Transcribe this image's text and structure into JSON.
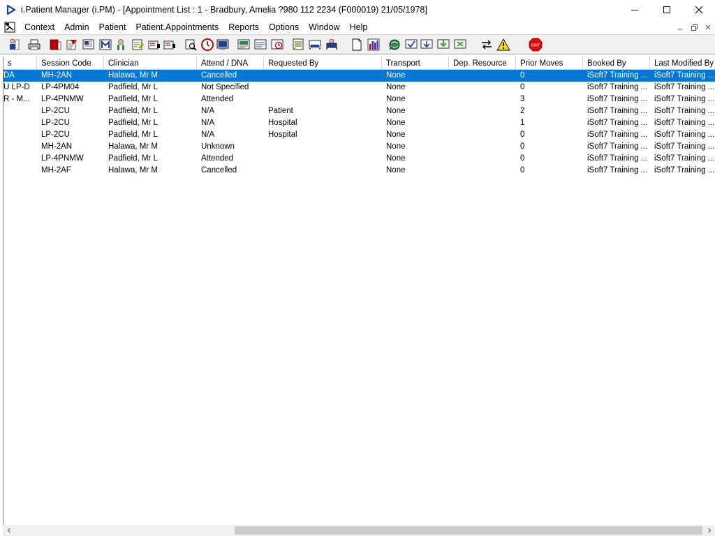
{
  "window": {
    "title": "i.Patient Manager (i.PM) - [Appointment List : 1 - Bradbury, Amelia ?980 112 2234 (F000019) 21/05/1978]"
  },
  "menu": {
    "items": [
      "Context",
      "Admin",
      "Patient",
      "Patient.Appointments",
      "Reports",
      "Options",
      "Window",
      "Help"
    ]
  },
  "toolbar": {
    "exit_label": "EXIT"
  },
  "list": {
    "columns": [
      "s",
      "Session Code",
      "Clinician",
      "Attend / DNA",
      "Requested By",
      "Transport",
      "Dep. Resource",
      "Prior Moves",
      "Booked By",
      "Last Modified By"
    ],
    "rows": [
      [
        "DA",
        "MH-2AN",
        "Halawa, Mr M",
        "Cancelled",
        "",
        "None",
        "",
        "0",
        "iSoft7 Training ...",
        "iSoft7 Training ..."
      ],
      [
        "U LP-D",
        "LP-4PM04",
        "Padfield, Mr L",
        "Not Specified",
        "",
        "None",
        "",
        "0",
        "iSoft7 Training ...",
        "iSoft7 Training ..."
      ],
      [
        "R - M...",
        "LP-4PNMW",
        "Padfield, Mr L",
        "Attended",
        "",
        "None",
        "",
        "3",
        "iSoft7 Training ...",
        "iSoft7 Training ..."
      ],
      [
        "",
        "LP-2CU",
        "Padfield, Mr L",
        "N/A",
        "Patient",
        "None",
        "",
        "2",
        "iSoft7 Training ...",
        "iSoft7 Training ..."
      ],
      [
        "",
        "LP-2CU",
        "Padfield, Mr L",
        "N/A",
        "Hospital",
        "None",
        "",
        "1",
        "iSoft7 Training ...",
        "iSoft7 Training ..."
      ],
      [
        "",
        "LP-2CU",
        "Padfield, Mr L",
        "N/A",
        "Hospital",
        "None",
        "",
        "0",
        "iSoft7 Training ...",
        "iSoft7 Training ..."
      ],
      [
        "",
        "MH-2AN",
        "Halawa, Mr M",
        "Unknown",
        "",
        "None",
        "",
        "0",
        "iSoft7 Training ...",
        "iSoft7 Training ..."
      ],
      [
        "",
        "LP-4PNMW",
        "Padfield, Mr L",
        "Attended",
        "",
        "None",
        "",
        "0",
        "iSoft7 Training ...",
        "iSoft7 Training ..."
      ],
      [
        "",
        "MH-2AF",
        "Halawa, Mr M",
        "Cancelled",
        "",
        "None",
        "",
        "0",
        "iSoft7 Training ...",
        "iSoft7 Training ..."
      ]
    ],
    "selected_row": 0
  },
  "colors": {
    "selection": "#0078d7",
    "toolbar_bg": "#f0f0f0"
  }
}
